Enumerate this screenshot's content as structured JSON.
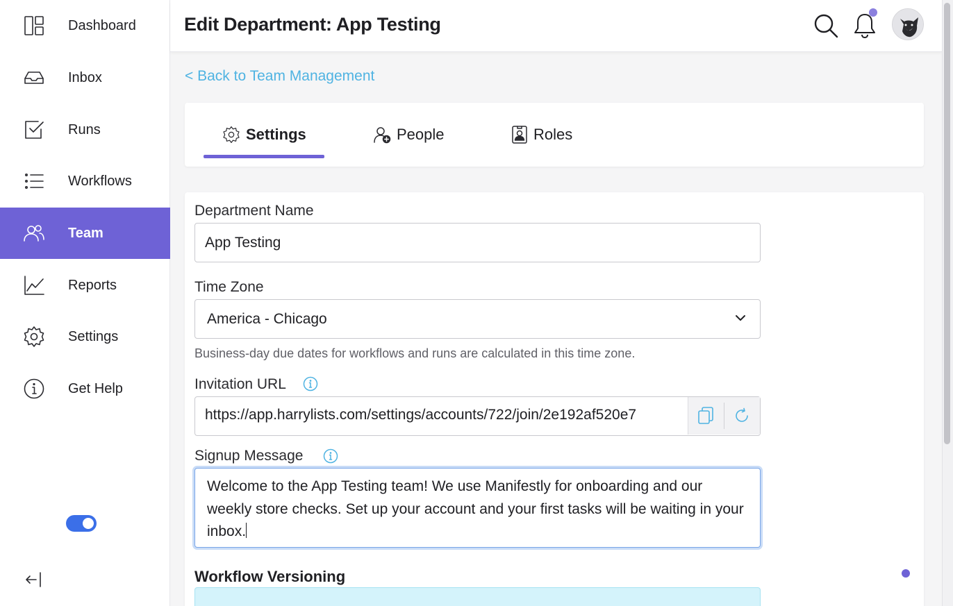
{
  "sidebar": {
    "items": [
      {
        "label": "Dashboard",
        "icon": "dashboard-icon"
      },
      {
        "label": "Inbox",
        "icon": "inbox-icon"
      },
      {
        "label": "Runs",
        "icon": "checkbox-icon"
      },
      {
        "label": "Workflows",
        "icon": "list-icon"
      },
      {
        "label": "Team",
        "icon": "team-icon",
        "active": true
      },
      {
        "label": "Reports",
        "icon": "chart-icon"
      },
      {
        "label": "Settings",
        "icon": "gear-icon"
      },
      {
        "label": "Get Help",
        "icon": "info-icon"
      }
    ],
    "toggle_on": true
  },
  "header": {
    "title": "Edit Department: App Testing"
  },
  "back_link": "< Back to Team Management",
  "tabs": [
    {
      "label": "Settings",
      "icon": "gear-icon",
      "active": true
    },
    {
      "label": "People",
      "icon": "user-plus-icon"
    },
    {
      "label": "Roles",
      "icon": "id-badge-icon"
    }
  ],
  "form": {
    "department_name_label": "Department Name",
    "department_name_value": "App Testing",
    "timezone_label": "Time Zone",
    "timezone_value": "America - Chicago",
    "timezone_help": "Business-day due dates for workflows and runs are calculated in this time zone.",
    "invitation_label": "Invitation URL",
    "invitation_url": "https://app.harrylists.com/settings/accounts/722/join/2e192af520e7",
    "signup_label": "Signup Message",
    "signup_message": "Welcome to the App Testing team! We use Manifestly for onboarding and our weekly store checks. Set up your account and your first tasks will be waiting in your inbox.",
    "versioning_title": "Workflow Versioning"
  },
  "colors": {
    "accent": "#6e62d6",
    "link": "#4fb3e2",
    "toggle": "#3b6fe8",
    "info_box": "#d4f3fb"
  }
}
